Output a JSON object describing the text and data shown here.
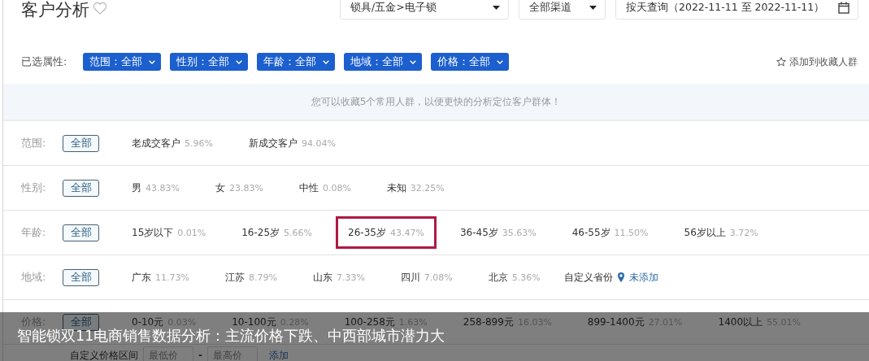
{
  "header": {
    "title": "客户分析",
    "favorited": false
  },
  "filters": [
    {
      "kind": "select",
      "value": "锁具/五金>电子锁"
    },
    {
      "kind": "select",
      "value": "全部渠道"
    },
    {
      "kind": "date",
      "value": "按天查询（2022-11-11 至 2022-11-11）"
    }
  ],
  "selected_attributes": {
    "label": "已选属性:",
    "chips": [
      "范围：全部",
      "性别：全部",
      "年龄：全部",
      "地域：全部",
      "价格：全部"
    ]
  },
  "add_favorite": "添加到收藏人群",
  "notice": "您可以收藏5个常用人群，以便更快的分析定位客户群体！",
  "attribute_rows": [
    {
      "label": "范围:",
      "all_button": "全部",
      "options": [
        {
          "name": "老成交客户",
          "share": "5.96%",
          "highlighted": false
        },
        {
          "name": "新成交客户",
          "share": "94.04%",
          "highlighted": false
        }
      ]
    },
    {
      "label": "性别:",
      "all_button": "全部",
      "options": [
        {
          "name": "男",
          "share": "43.83%",
          "highlighted": false
        },
        {
          "name": "女",
          "share": "23.83%",
          "highlighted": false
        },
        {
          "name": "中性",
          "share": "0.08%",
          "highlighted": false
        },
        {
          "name": "未知",
          "share": "32.25%",
          "highlighted": false
        }
      ]
    },
    {
      "label": "年龄:",
      "all_button": "全部",
      "options": [
        {
          "name": "15岁以下",
          "share": "0.01%",
          "highlighted": false
        },
        {
          "name": "16-25岁",
          "share": "5.66%",
          "highlighted": false
        },
        {
          "name": "26-35岁",
          "share": "43.47%",
          "highlighted": true
        },
        {
          "name": "36-45岁",
          "share": "35.63%",
          "highlighted": false
        },
        {
          "name": "46-55岁",
          "share": "11.50%",
          "highlighted": false
        },
        {
          "name": "56岁以上",
          "share": "3.72%",
          "highlighted": false
        }
      ]
    },
    {
      "label": "地域:",
      "all_button": "全部",
      "options": [
        {
          "name": "广东",
          "share": "11.73%",
          "highlighted": false
        },
        {
          "name": "江苏",
          "share": "8.79%",
          "highlighted": false
        },
        {
          "name": "山东",
          "share": "7.33%",
          "highlighted": false
        },
        {
          "name": "四川",
          "share": "7.08%",
          "highlighted": false
        },
        {
          "name": "北京",
          "share": "5.36%",
          "highlighted": false
        }
      ],
      "custom": {
        "label": "自定义省份",
        "link": "未添加"
      }
    },
    {
      "label": "价格:",
      "all_button": "全部",
      "options": [
        {
          "name": "0-10元",
          "share": "0.03%",
          "highlighted": false
        },
        {
          "name": "10-100元",
          "share": "0.28%",
          "highlighted": false
        },
        {
          "name": "100-258元",
          "share": "1.63%",
          "highlighted": false
        },
        {
          "name": "258-899元",
          "share": "16.03%",
          "highlighted": false
        },
        {
          "name": "899-1400元",
          "share": "27.01%",
          "highlighted": false
        },
        {
          "name": "1400以上",
          "share": "55.01%",
          "highlighted": false
        }
      ]
    }
  ],
  "custom_price": {
    "label": "自定义价格区间",
    "min_placeholder": "最低价",
    "separator": "-",
    "max_placeholder": "最高价",
    "add": "添加"
  },
  "caption": "智能锁双11电商销售数据分析：主流价格下跌、中西部城市潜力大"
}
